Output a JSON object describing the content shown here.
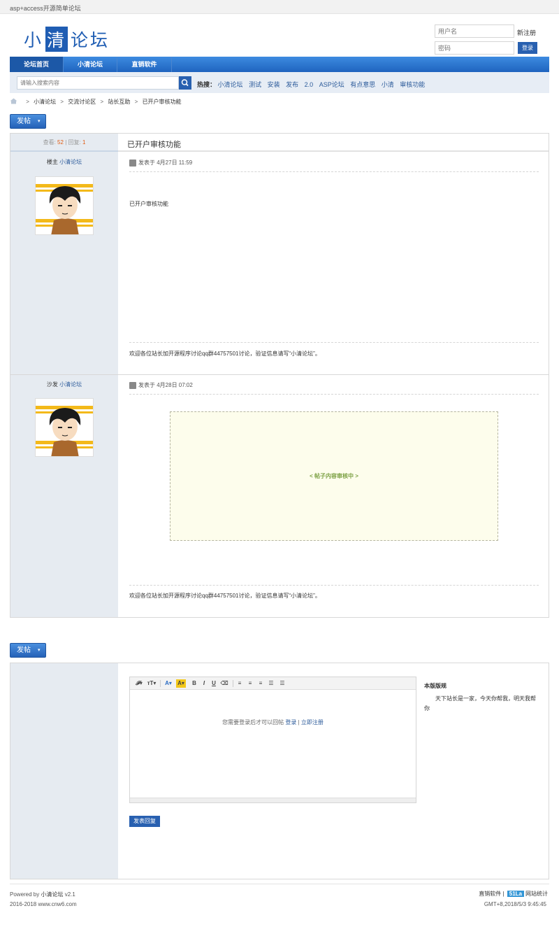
{
  "topbar": {
    "title": "asp+access开源简单论坛"
  },
  "logo": {
    "part1": "小",
    "part2": "清",
    "part3": "论坛"
  },
  "login": {
    "username_placeholder": "用户名",
    "password_placeholder": "密码",
    "register": "新注册",
    "login_button": "登录"
  },
  "nav": {
    "items": [
      {
        "label": "论坛首页",
        "active": true
      },
      {
        "label": "小清论坛"
      },
      {
        "label": "直销软件"
      }
    ]
  },
  "search": {
    "placeholder": "请输入搜索内容",
    "hot_label": "热搜：",
    "hot_items": [
      "小清论坛",
      "测试",
      "安装",
      "发布",
      "2.0",
      "ASP论坛",
      "有点意思",
      "小清",
      "审核功能"
    ]
  },
  "breadcrumb": [
    "小清论坛",
    "交流讨论区",
    "站长互助",
    "已开户审核功能"
  ],
  "post_button": "发帖",
  "thread": {
    "views_label": "查看:",
    "views": "52",
    "sep": "|",
    "replies_label": "回复:",
    "replies": "1",
    "title": "已开户审核功能",
    "posts": [
      {
        "floor": "楼主",
        "author": "小清论坛",
        "posted_label": "发表于",
        "date": "4月27日 11:59",
        "body": "已开户审核功能",
        "signature": "欢迎各位站长加开源程序讨论qq群44757501讨论，验证信息请写“小清论坛”。"
      },
      {
        "floor": "沙发",
        "author": "小清论坛",
        "posted_label": "发表于",
        "date": "4月28日 07:02",
        "pending": "< 帖子内容审核中 >",
        "signature": "欢迎各位站长加开源程序讨论qq群44757501讨论，验证信息请写“小清论坛”。"
      }
    ]
  },
  "reply": {
    "need_login": "您需要登录后才可以回帖",
    "login_link": "登录",
    "sep": "|",
    "register_link": "立即注册",
    "submit": "发表回复",
    "rules_title": "本版版规",
    "rules_text": "天下站长是一家，今天你帮我，明天我帮你"
  },
  "footer": {
    "powered_prefix": "Powered by",
    "powered_name": "小清论坛",
    "version": "v2.1",
    "copyright": "2016-2018 www.cnw6.com",
    "right_link": "直销软件",
    "stats_badge": "51La",
    "stats_label": "网站统计",
    "time": "GMT+8,2018/5/3 9:45:45"
  },
  "colors": {
    "brand": "#1f5db3",
    "nav": "#2a6fc9",
    "accent": "#2860b0",
    "pending_bg": "#fdfdec"
  }
}
